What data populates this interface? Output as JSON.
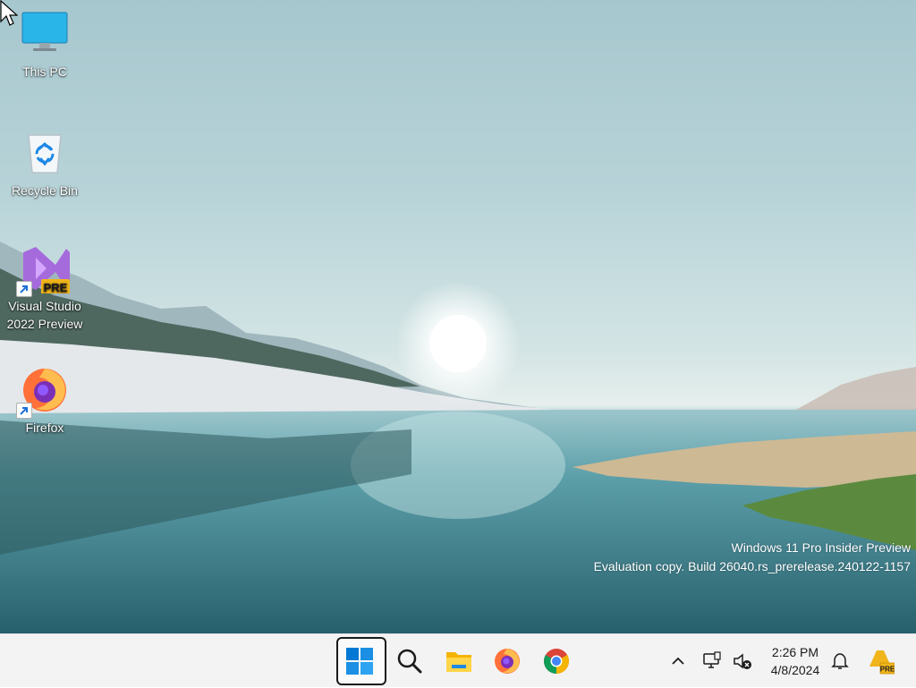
{
  "desktop": {
    "icons": [
      {
        "label": "This PC",
        "icon": "computer-monitor-icon"
      },
      {
        "label": "Recycle Bin",
        "icon": "recycle-bin-icon"
      },
      {
        "label": "Visual Studio 2022 Preview",
        "icon": "visual-studio-preview-icon",
        "badge": "PRE"
      },
      {
        "label": "Firefox",
        "icon": "firefox-icon"
      }
    ],
    "watermark": {
      "line1": "Windows 11 Pro Insider Preview",
      "line2": "Evaluation copy. Build 26040.rs_prerelease.240122-1157"
    }
  },
  "taskbar": {
    "pinned": [
      "windows-start-icon",
      "search-icon",
      "file-explorer-icon",
      "firefox-icon",
      "chrome-icon"
    ],
    "tray": {
      "icons": [
        "chevron-up-icon",
        "network-icon",
        "volume-muted-icon",
        "notification-bell-icon",
        "windows-insider-pre-icon"
      ],
      "time": "2:26 PM",
      "date": "4/8/2024",
      "insider_badge": "PRE"
    }
  },
  "colors": {
    "taskbar_bg": "#f3f3f3",
    "accent_blue": "#0078d4",
    "vs_purple": "#a56bdc",
    "pre_badge": "#f0b51b"
  }
}
